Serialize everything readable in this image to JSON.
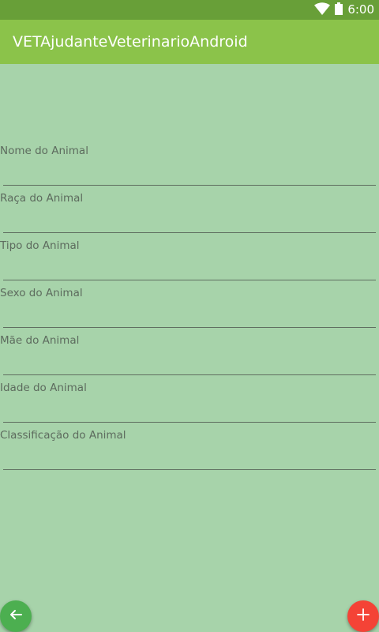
{
  "status_bar": {
    "time": "6:00",
    "icons": [
      "wifi-icon",
      "battery-icon"
    ]
  },
  "app_bar": {
    "title": "VETAjudanteVeterinarioAndroid",
    "color": "#8bc34a"
  },
  "form": {
    "fields": [
      {
        "label": "Nome do Animal",
        "value": ""
      },
      {
        "label": "Raça do Animal",
        "value": ""
      },
      {
        "label": "Tipo do Animal",
        "value": ""
      },
      {
        "label": "Sexo do Animal",
        "value": ""
      },
      {
        "label": "Mãe do Animal",
        "value": ""
      },
      {
        "label": "Idade do Animal",
        "value": ""
      },
      {
        "label": "Classificação do Animal",
        "value": ""
      }
    ]
  },
  "buttons": {
    "back": {
      "icon": "arrow-left-icon",
      "color": "#4caf50"
    },
    "add": {
      "icon": "plus-icon",
      "color": "#f44336"
    }
  },
  "colors": {
    "background": "#a7d3aa",
    "status_bar": "#689f38"
  }
}
